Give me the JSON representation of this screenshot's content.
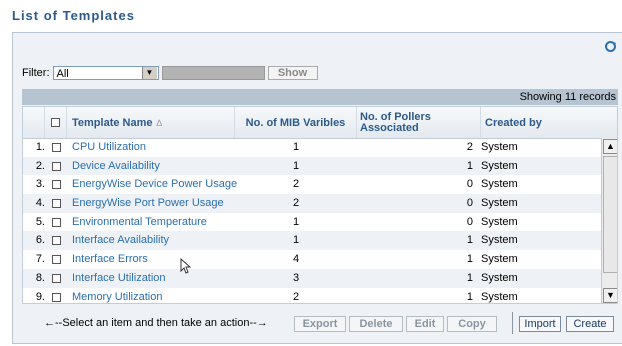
{
  "page": {
    "title": "List of Templates"
  },
  "filter": {
    "label": "Filter:",
    "selected": "All",
    "show_label": "Show"
  },
  "status": {
    "text": "Showing 11 records"
  },
  "table": {
    "columns": {
      "name": "Template Name",
      "sort_indicator": "∆",
      "mib": "No. of MIB Varibles",
      "pollers": "No. of Pollers Associated",
      "created": "Created by"
    },
    "rows": [
      {
        "num": "1.",
        "name": "CPU Utilization",
        "mib": "1",
        "pollers": "2",
        "created": "System"
      },
      {
        "num": "2.",
        "name": "Device Availability",
        "mib": "1",
        "pollers": "1",
        "created": "System"
      },
      {
        "num": "3.",
        "name": "EnergyWise Device Power Usage",
        "mib": "2",
        "pollers": "0",
        "created": "System"
      },
      {
        "num": "4.",
        "name": "EnergyWise Port Power Usage",
        "mib": "2",
        "pollers": "0",
        "created": "System"
      },
      {
        "num": "5.",
        "name": "Environmental Temperature",
        "mib": "1",
        "pollers": "0",
        "created": "System"
      },
      {
        "num": "6.",
        "name": "Interface Availability",
        "mib": "1",
        "pollers": "1",
        "created": "System"
      },
      {
        "num": "7.",
        "name": "Interface Errors",
        "mib": "4",
        "pollers": "1",
        "created": "System"
      },
      {
        "num": "8.",
        "name": "Interface Utilization",
        "mib": "3",
        "pollers": "1",
        "created": "System"
      },
      {
        "num": "9.",
        "name": "Memory Utilization",
        "mib": "2",
        "pollers": "1",
        "created": "System"
      }
    ]
  },
  "actions": {
    "hint": "←--Select an item and then take an action--→",
    "export": "Export",
    "delete": "Delete",
    "edit": "Edit",
    "copy": "Copy",
    "import": "Import",
    "create": "Create"
  },
  "colors": {
    "title": "#2c5a8a",
    "link": "#2a6fb0",
    "status_bar": "#b6c3d0"
  },
  "icons": [
    "refresh-icon",
    "sort-ascending-icon",
    "dropdown-arrow-icon",
    "scroll-up-icon",
    "scroll-down-icon",
    "mouse-pointer-icon"
  ]
}
